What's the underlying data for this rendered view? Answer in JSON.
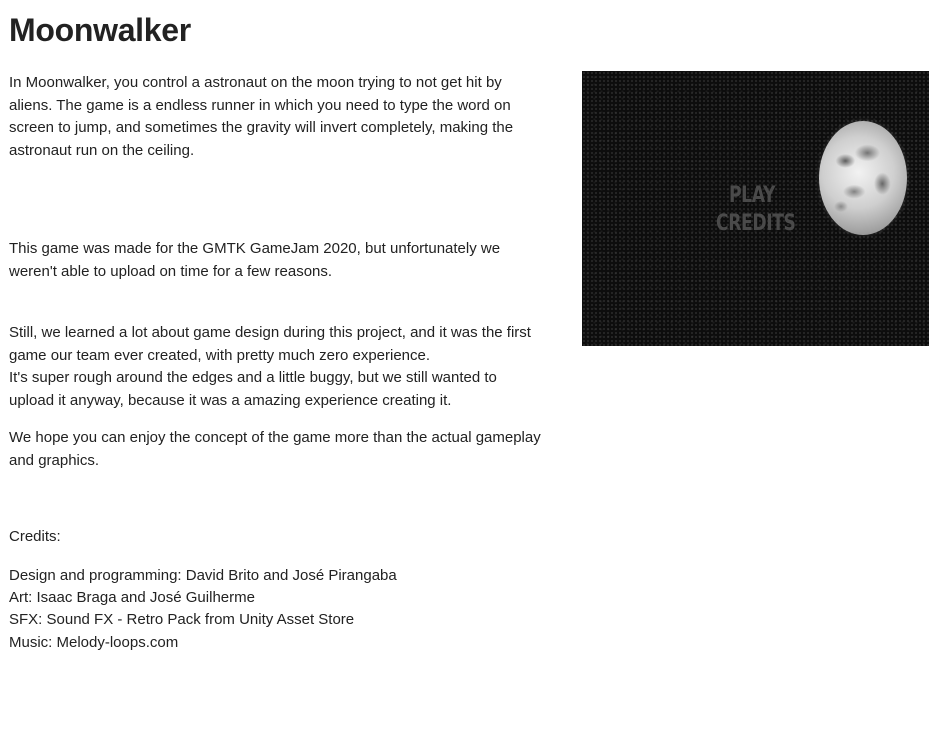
{
  "title": "Moonwalker",
  "paragraphs": {
    "intro": "In Moonwalker, you control a astronaut on the moon trying to not get hit by\naliens. The game is a endless runner in which you need to type the word on\nscreen to jump, and sometimes the gravity will invert completely, making the\nastronaut run on the ceiling.",
    "jam": "This game was made for the GMTK GameJam 2020, but unfortunately we\nweren't able to upload on time for a few reasons.",
    "learned": "Still, we learned a lot about game design during this project, and it was the first\ngame our team ever created, with pretty much zero experience.\nIt's super rough around the edges and a little buggy, but we still wanted to\nupload it anyway, because it was a amazing experience creating it.",
    "hope": "We hope you can enjoy the concept of the game more than the actual gameplay\nand graphics."
  },
  "credits": {
    "heading": "Credits:",
    "lines": [
      "Design and programming: David Brito and José Pirangaba",
      "Art: Isaac Braga and José Guilherme",
      "SFX: Sound FX - Retro Pack from Unity Asset Store",
      "Music: Melody-loops.com"
    ]
  },
  "screenshot": {
    "menu_play": "PLAY",
    "menu_credits": "CREDITS",
    "background_color": "#0d0d0d",
    "moon_icon": "moon-icon"
  }
}
